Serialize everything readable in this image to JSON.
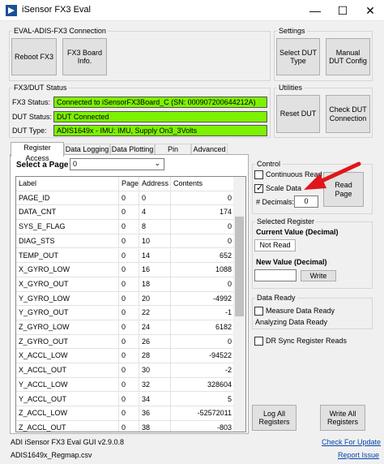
{
  "window": {
    "title": "iSensor FX3 Eval",
    "minimize": "—",
    "maximize": "☐",
    "close": "✕"
  },
  "connection_group": {
    "title": "EVAL-ADIS-FX3 Connection",
    "reboot": "Reboot FX3",
    "board_info": "FX3 Board Info."
  },
  "settings_group": {
    "title": "Settings",
    "select_dut": "Select DUT Type",
    "manual_dut": "Manual DUT Config"
  },
  "status_group": {
    "title": "FX3/DUT Status",
    "fx3_label": "FX3 Status:",
    "fx3_value": "Connected to iSensorFX3Board_C (SN: 000907200644212A)",
    "dut_label": "DUT Status:",
    "dut_value": "DUT Connected",
    "type_label": "DUT Type:",
    "type_value": "ADIS1649x - IMU: IMU, Supply On3_3Volts"
  },
  "utilities_group": {
    "title": "Utilities",
    "reset_dut": "Reset DUT",
    "check_dut": "Check DUT Connection"
  },
  "tabs": [
    "Register Access",
    "Data Logging",
    "Data Plotting",
    "Pin Access",
    "Advanced"
  ],
  "register_access": {
    "select_page_label": "Select a Page",
    "select_page_value": "0",
    "columns": [
      "Label",
      "Page",
      "Address",
      "Contents"
    ],
    "rows": [
      [
        "PAGE_ID",
        "0",
        "0",
        "0"
      ],
      [
        "DATA_CNT",
        "0",
        "4",
        "174"
      ],
      [
        "SYS_E_FLAG",
        "0",
        "8",
        "0"
      ],
      [
        "DIAG_STS",
        "0",
        "10",
        "0"
      ],
      [
        "TEMP_OUT",
        "0",
        "14",
        "652"
      ],
      [
        "X_GYRO_LOW",
        "0",
        "16",
        "1088"
      ],
      [
        "X_GYRO_OUT",
        "0",
        "18",
        "0"
      ],
      [
        "Y_GYRO_LOW",
        "0",
        "20",
        "-4992"
      ],
      [
        "Y_GYRO_OUT",
        "0",
        "22",
        "-1"
      ],
      [
        "Z_GYRO_LOW",
        "0",
        "24",
        "6182"
      ],
      [
        "Z_GYRO_OUT",
        "0",
        "26",
        "0"
      ],
      [
        "X_ACCL_LOW",
        "0",
        "28",
        "-94522"
      ],
      [
        "X_ACCL_OUT",
        "0",
        "30",
        "-2"
      ],
      [
        "Y_ACCL_LOW",
        "0",
        "32",
        "328604"
      ],
      [
        "Y_ACCL_OUT",
        "0",
        "34",
        "5"
      ],
      [
        "Z_ACCL_LOW",
        "0",
        "36",
        "-52572011"
      ],
      [
        "Z_ACCL_OUT",
        "0",
        "38",
        "-803"
      ]
    ]
  },
  "control_group": {
    "title": "Control",
    "continuous_read": "Continuous Read",
    "scale_data": "Scale Data",
    "decimals_label": "# Decimals:",
    "decimals_value": "0",
    "read_page": "Read Page"
  },
  "selected_register": {
    "title": "Selected Register",
    "current_label": "Current Value (Decimal)",
    "current_value": "Not Read",
    "new_label": "New Value (Decimal)",
    "new_value": "",
    "write": "Write"
  },
  "data_ready": {
    "title": "Data Ready",
    "measure": "Measure Data Ready",
    "analyzing": "Analyzing Data Ready",
    "dr_sync": "DR Sync Register Reads"
  },
  "log_all": "Log All Registers",
  "write_all": "Write All Registers",
  "footer": {
    "version": "ADI iSensor FX3 Eval GUI v2.9.0.8",
    "regmap": "ADIS1649x_Regmap.csv",
    "check_update": "Check For Update",
    "report_issue": "Report Issue"
  },
  "colors": {
    "status_ok": "#7df200",
    "annotation_arrow": "#e0161b"
  }
}
